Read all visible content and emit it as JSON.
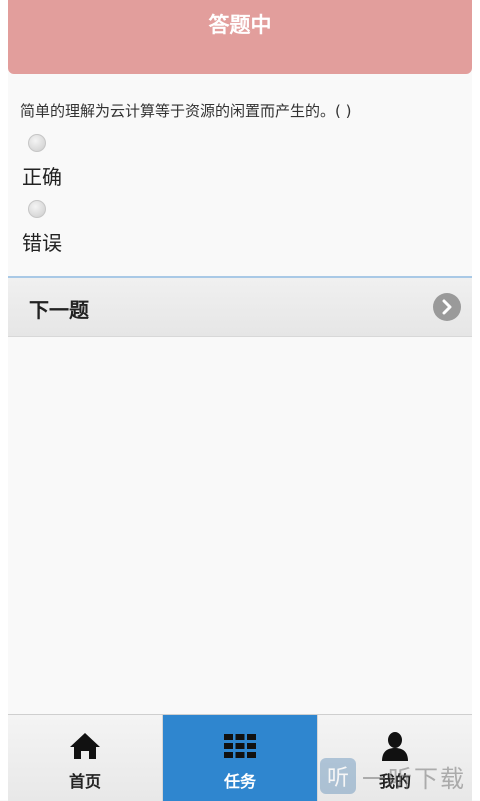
{
  "header": {
    "title": "答题中"
  },
  "question": {
    "text": "简单的理解为云计算等于资源的闲置而产生的。( )"
  },
  "options": [
    {
      "label": "正确"
    },
    {
      "label": "错误"
    }
  ],
  "next": {
    "label": "下一题",
    "icon": "chevron-right-icon"
  },
  "tabbar": {
    "items": [
      {
        "label": "首页",
        "icon": "home-icon",
        "active": false
      },
      {
        "label": "任务",
        "icon": "grid-icon",
        "active": true
      },
      {
        "label": "我的",
        "icon": "user-icon",
        "active": false
      }
    ],
    "active_color": "#2f86cf"
  },
  "watermark": {
    "text": "一听下载"
  },
  "colors": {
    "header": "#e29e9c",
    "background": "#f9f9f9"
  }
}
